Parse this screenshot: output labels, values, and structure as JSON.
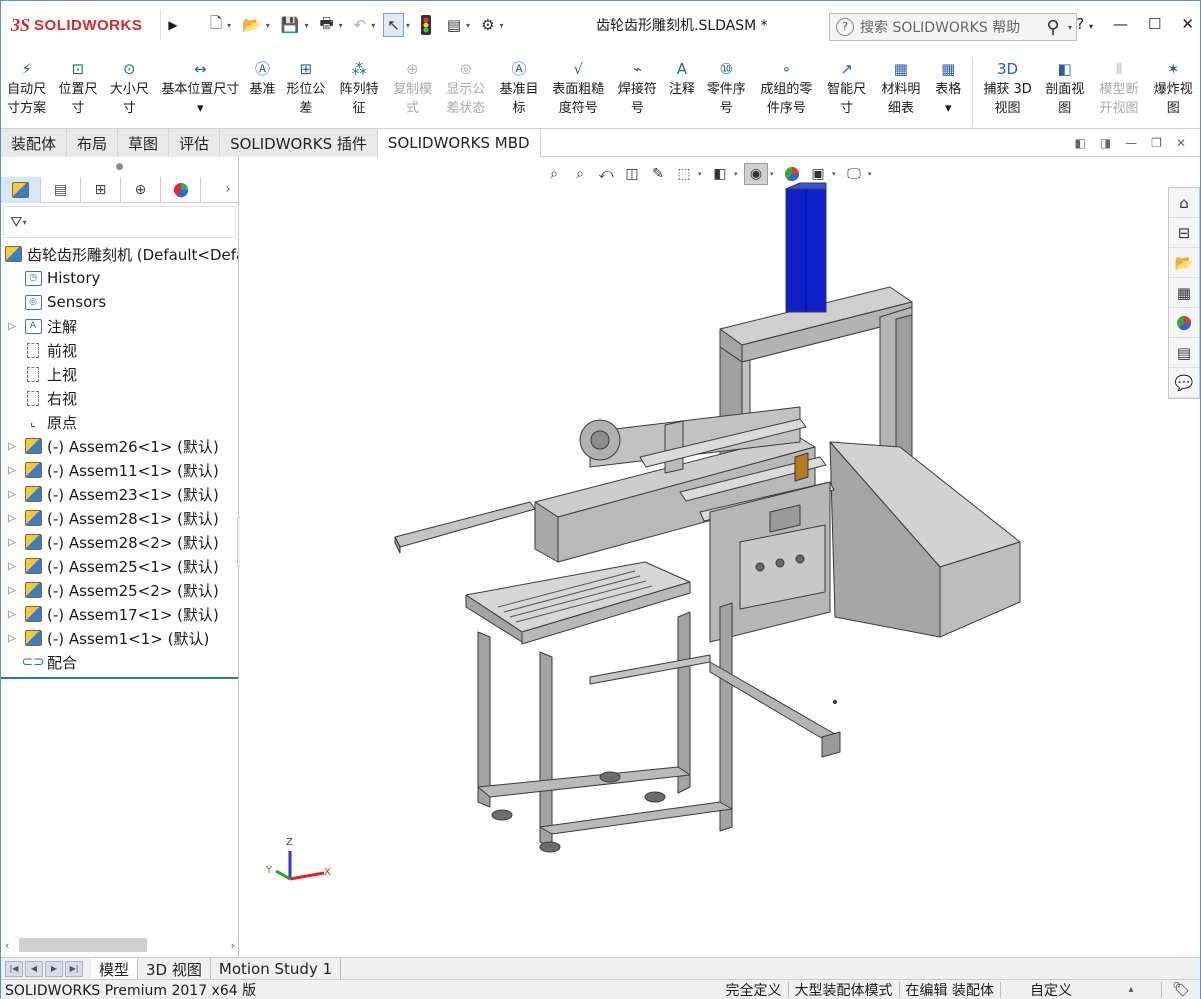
{
  "app": {
    "logo_ds": "3S",
    "logo_text": "SOLIDWORKS",
    "window_title": "齿轮齿形雕刻机.SLDASM *",
    "search_placeholder": "搜索 SOLIDWORKS 帮助",
    "help_label": "?"
  },
  "command_manager": {
    "buttons": [
      {
        "label": "自动尺\n寸方案",
        "icon": "auto-dimension-icon",
        "enabled": true
      },
      {
        "label": "位置尺\n寸",
        "icon": "location-dimension-icon",
        "enabled": true
      },
      {
        "label": "大小尺\n寸",
        "icon": "size-dimension-icon",
        "enabled": true
      },
      {
        "label": "基本位置尺寸\n▾",
        "icon": "basic-location-dimension-icon",
        "enabled": true
      },
      {
        "label": "基准",
        "icon": "datum-icon",
        "enabled": true
      },
      {
        "label": "形位公\n差",
        "icon": "gtol-icon",
        "enabled": true
      },
      {
        "label": "阵列特\n征",
        "icon": "pattern-feature-icon",
        "enabled": true
      },
      {
        "label": "复制模\n式",
        "icon": "copy-scheme-icon",
        "enabled": false
      },
      {
        "label": "显示公\n差状态",
        "icon": "tolerance-status-icon",
        "enabled": false
      },
      {
        "label": "基准目\n标",
        "icon": "datum-target-icon",
        "enabled": true
      },
      {
        "label": "表面粗糙\n度符号",
        "icon": "surface-finish-icon",
        "enabled": true
      },
      {
        "label": "焊接符\n号",
        "icon": "weld-symbol-icon",
        "enabled": true
      },
      {
        "label": "注释",
        "icon": "note-icon",
        "enabled": true
      },
      {
        "label": "零件序\n号",
        "icon": "balloon-icon",
        "enabled": true
      },
      {
        "label": "成组的零\n件序号",
        "icon": "stacked-balloon-icon",
        "enabled": true
      },
      {
        "label": "智能尺\n寸",
        "icon": "smart-dimension-icon",
        "enabled": true
      },
      {
        "label": "材料明\n细表",
        "icon": "bom-icon",
        "enabled": true
      },
      {
        "label": "表格\n▾",
        "icon": "table-icon",
        "enabled": true
      },
      {
        "label": "捕获 3D\n视图",
        "icon": "capture-3d-view-icon",
        "enabled": true
      },
      {
        "label": "剖面视\n图",
        "icon": "section-view-icon",
        "enabled": true
      },
      {
        "label": "模型断\n开视图",
        "icon": "model-break-view-icon",
        "enabled": false
      },
      {
        "label": "爆炸视\n图",
        "icon": "exploded-view-icon",
        "enabled": true
      }
    ]
  },
  "tabs": [
    "装配体",
    "布局",
    "草图",
    "评估",
    "SOLIDWORKS 插件",
    "SOLIDWORKS MBD"
  ],
  "active_tab": "SOLIDWORKS MBD",
  "feature_tree": {
    "root": "齿轮齿形雕刻机 (Default<Defa",
    "items": [
      {
        "label": "History",
        "icon": "history-icon",
        "expandable": false
      },
      {
        "label": "Sensors",
        "icon": "sensors-icon",
        "expandable": false
      },
      {
        "label": "注解",
        "icon": "annotations-icon",
        "expandable": true
      },
      {
        "label": "前视",
        "icon": "plane-icon",
        "expandable": false
      },
      {
        "label": "上视",
        "icon": "plane-icon",
        "expandable": false
      },
      {
        "label": "右视",
        "icon": "plane-icon",
        "expandable": false
      },
      {
        "label": "原点",
        "icon": "origin-icon",
        "expandable": false
      },
      {
        "label": "(-) Assem26<1> (默认)",
        "icon": "subassembly-icon",
        "expandable": true
      },
      {
        "label": "(-) Assem11<1> (默认)",
        "icon": "subassembly-icon",
        "expandable": true
      },
      {
        "label": "(-) Assem23<1> (默认)",
        "icon": "subassembly-icon",
        "expandable": true
      },
      {
        "label": "(-) Assem28<1> (默认)",
        "icon": "subassembly-icon",
        "expandable": true
      },
      {
        "label": "(-) Assem28<2> (默认)",
        "icon": "subassembly-icon",
        "expandable": true
      },
      {
        "label": "(-) Assem25<1> (默认)",
        "icon": "subassembly-icon",
        "expandable": true
      },
      {
        "label": "(-) Assem25<2> (默认)",
        "icon": "subassembly-icon",
        "expandable": true
      },
      {
        "label": "(-) Assem17<1> (默认)",
        "icon": "subassembly-icon",
        "expandable": true
      },
      {
        "label": "(-) Assem1<1> (默认)",
        "icon": "subassembly-icon",
        "expandable": true
      },
      {
        "label": "配合",
        "icon": "mates-icon",
        "expandable": false
      }
    ]
  },
  "triad": {
    "x": "X",
    "y": "Y",
    "z": "Z"
  },
  "bottom_tabs": [
    "模型",
    "3D 视图",
    "Motion Study 1"
  ],
  "active_bottom_tab": "模型",
  "status_bar": {
    "product": "SOLIDWORKS Premium 2017 x64 版",
    "state": "完全定义",
    "mode": "大型装配体模式",
    "editing": "在编辑 装配体",
    "units": "自定义"
  },
  "colors": {
    "brand_red": "#d8272e",
    "selected_part_blue": "#1020c8",
    "model_grey": "#b4b4b4",
    "tree_accent": "#2d6fc5"
  }
}
